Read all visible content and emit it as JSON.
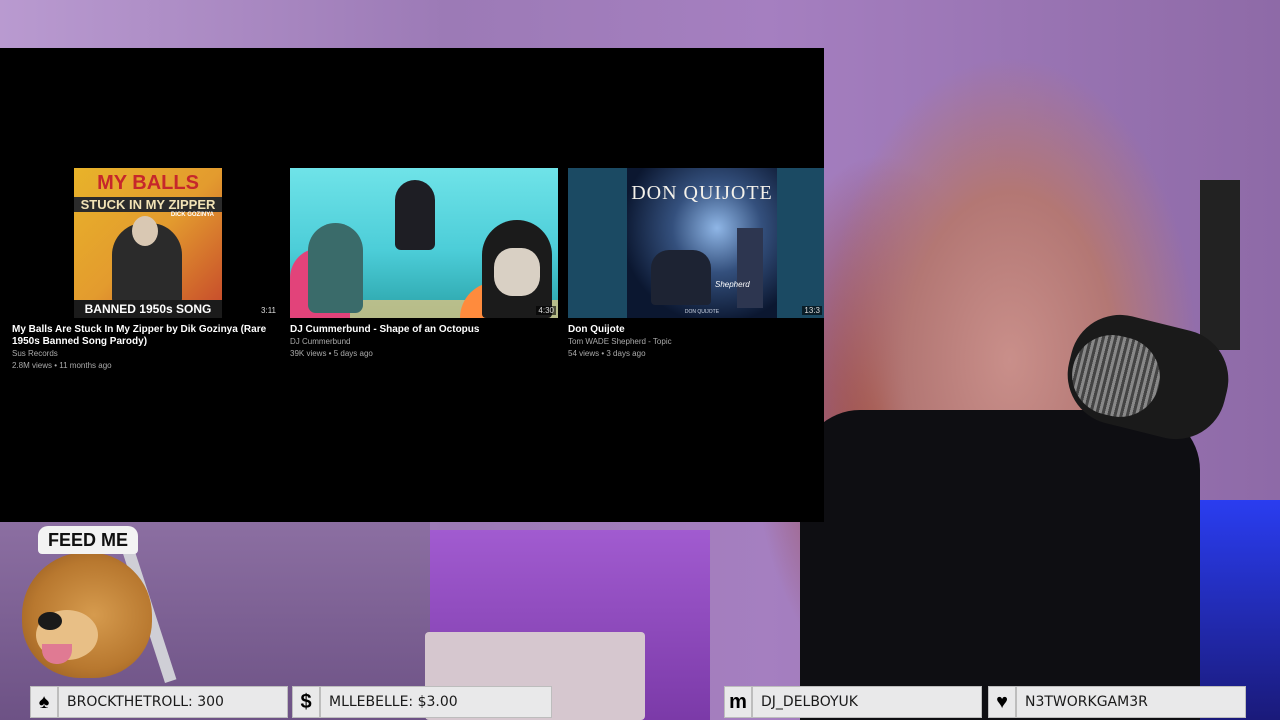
{
  "player": {
    "videos": [
      {
        "title": "My Balls Are Stuck In My Zipper by Dik Gozinya (Rare 1950s Banned Song Parody)",
        "channel": "Sus Records",
        "meta": "2.8M views • 11 months ago",
        "duration": "3:11",
        "thumb_text": {
          "line1": "MY BALLS",
          "line2": "STUCK IN MY ZIPPER",
          "line3": "DICK GOZINYA",
          "banner": "BANNED 1950s SONG"
        }
      },
      {
        "title": "DJ Cummerbund - Shape of an Octopus",
        "channel": "DJ Cummerbund",
        "meta": "39K views • 5 days ago",
        "duration": "4:30"
      },
      {
        "title": "Don Quijote",
        "channel": "Tom WADE Shepherd - Topic",
        "meta": "54 views • 3 days ago",
        "duration": "13:3",
        "thumb_text": {
          "title": "DON QUIJOTE",
          "signature": "Shepherd",
          "subtitle": "DON QUIJOTE"
        }
      }
    ]
  },
  "overlay": {
    "dog_hat": "FEED ME"
  },
  "ticker": [
    {
      "icon": "♠",
      "icon_name": "spade-icon",
      "text": "BROCKTHETROLL: 300"
    },
    {
      "icon": "$",
      "icon_name": "dollar-icon",
      "text": "MLLEBELLE: $3.00"
    },
    {
      "icon": "m",
      "icon_name": "m-icon",
      "text": "DJ_DELBOYUK"
    },
    {
      "icon": "♥",
      "icon_name": "heart-icon",
      "text": "N3TWORKGAM3R"
    }
  ],
  "colors": {
    "ticker_bg": "#e9e9ea",
    "player_bg": "#000000",
    "stream_wall": "#a57fc0"
  }
}
